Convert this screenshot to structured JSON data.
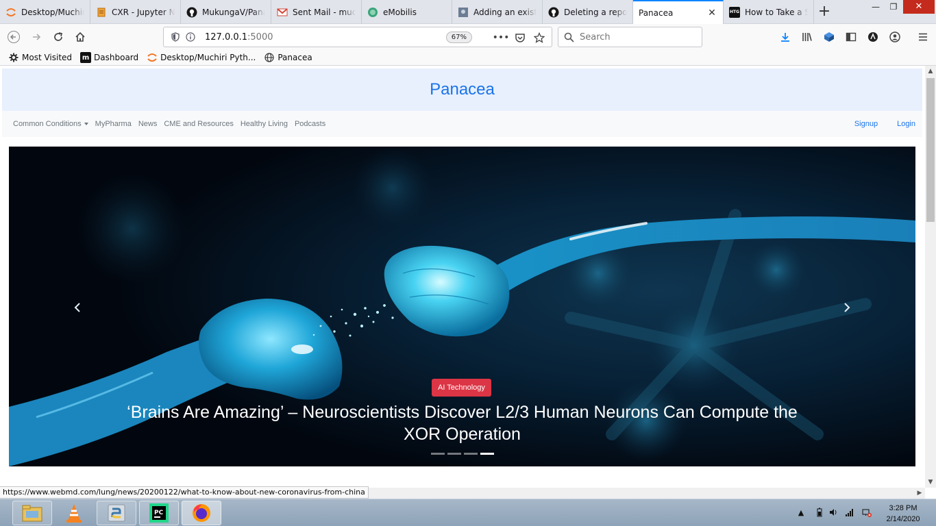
{
  "browser": {
    "tabs": [
      {
        "title": "Desktop/Muchiri",
        "favicon": "jupyter-icon",
        "active": false
      },
      {
        "title": "CXR - Jupyter Nc",
        "favicon": "notebook-icon",
        "active": false
      },
      {
        "title": "MukungaV/Pana",
        "favicon": "github-icon",
        "active": false
      },
      {
        "title": "Sent Mail - much",
        "favicon": "gmail-icon",
        "active": false
      },
      {
        "title": "eMobilis",
        "favicon": "globe-icon",
        "active": false
      },
      {
        "title": "Adding an existin",
        "favicon": "page-icon",
        "active": false
      },
      {
        "title": "Deleting a reposi",
        "favicon": "github-icon",
        "active": false
      },
      {
        "title": "Panacea",
        "favicon": "none",
        "active": true
      },
      {
        "title": "How to Take a Sc",
        "favicon": "htg-icon",
        "active": false
      }
    ],
    "url": {
      "host": "127.0.0.1",
      "port": ":5000"
    },
    "zoom": "67%",
    "search_placeholder": "Search",
    "bookmarks": [
      {
        "label": "Most Visited",
        "icon": "gear-icon"
      },
      {
        "label": "Dashboard",
        "icon": "m-logo-icon"
      },
      {
        "label": "Desktop/Muchiri Pyth...",
        "icon": "jupyter-icon"
      },
      {
        "label": "Panacea",
        "icon": "globe-icon"
      }
    ],
    "status_url": "https://www.webmd.com/lung/news/20200122/what-to-know-about-new-coronavirus-from-china"
  },
  "site": {
    "title": "Panacea",
    "nav": [
      {
        "label": "Common Conditions",
        "dropdown": true
      },
      {
        "label": "MyPharma"
      },
      {
        "label": "News"
      },
      {
        "label": "CME and Resources"
      },
      {
        "label": "Healthy Living"
      },
      {
        "label": "Podcasts"
      }
    ],
    "auth": {
      "signup": "Signup",
      "login": "Login"
    },
    "carousel": {
      "badge": "AI Technology",
      "caption": "‘Brains Are Amazing’ – Neuroscientists Discover L2/3 Human Neurons Can Compute the XOR Operation",
      "slides": 4,
      "active_slide": 4,
      "prev_icon": "chevron-left-icon",
      "next_icon": "chevron-right-icon"
    }
  },
  "taskbar": {
    "apps": [
      "file-explorer-icon",
      "vlc-icon",
      "python-icon",
      "pycharm-icon",
      "firefox-icon"
    ],
    "time": "3:28 PM",
    "date": "2/14/2020"
  },
  "colors": {
    "accent": "#0a84ff",
    "site_blue": "#1a73e8",
    "header_bg": "#e8f0fe",
    "badge_red": "#dc3545"
  }
}
